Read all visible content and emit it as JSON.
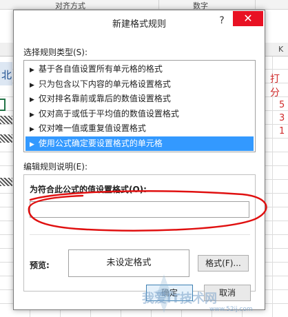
{
  "sheet": {
    "ribbon_groups": [
      "对齐方式",
      "数字"
    ],
    "column_header_k": "K",
    "left_partial_char": "北",
    "right_partial_text": "打分",
    "right_numbers": [
      "5",
      "3",
      "1"
    ]
  },
  "dialog": {
    "title": "新建格式规则",
    "help_label": "?",
    "close_label": "✕",
    "rule_type_label": "选择规则类型(S):",
    "rule_types": [
      "基于各自值设置所有单元格的格式",
      "只为包含以下内容的单元格设置格式",
      "仅对排名靠前或靠后的数值设置格式",
      "仅对高于或低于平均值的数值设置格式",
      "仅对唯一值或重复值设置格式",
      "使用公式确定要设置格式的单元格"
    ],
    "selected_rule_index": 5,
    "edit_desc_label": "编辑规则说明(E):",
    "formula_label": "为符合此公式的值设置格式(O):",
    "formula_value": "",
    "preview_label": "预览:",
    "preview_text": "未设定格式",
    "format_button": "格式(F)...",
    "ok_button": "确定",
    "cancel_button": "取消"
  },
  "watermark": {
    "text": "我爱IT技术网",
    "url": "www.52ij.com"
  },
  "colors": {
    "close_red": "#e81123",
    "selection_blue": "#3399ff",
    "annotation_red": "#e01010"
  }
}
